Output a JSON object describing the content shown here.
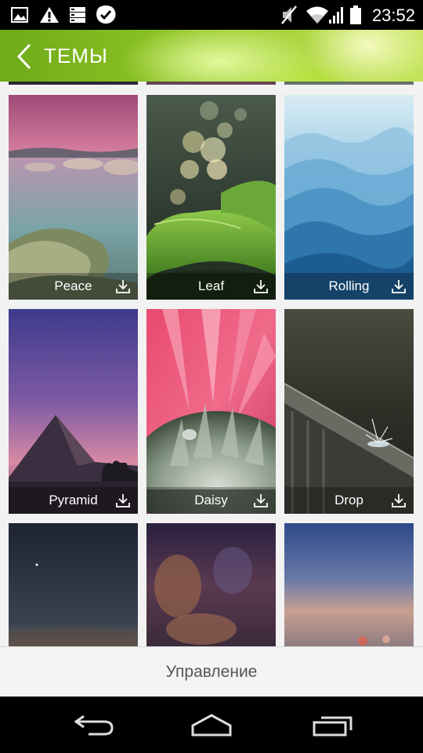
{
  "status_bar": {
    "time": "23:52",
    "icons": [
      "image-notification-icon",
      "warning-icon",
      "storage-icon",
      "check-badge-icon",
      "mute-icon",
      "wifi-icon",
      "signal-icon",
      "battery-icon"
    ]
  },
  "header": {
    "title": "ТЕМЫ",
    "back_icon": "chevron-left-icon",
    "accent_color": "#89c022"
  },
  "themes": [
    {
      "name": "Peace",
      "download_icon": "download-icon"
    },
    {
      "name": "Leaf",
      "download_icon": "download-icon"
    },
    {
      "name": "Rolling",
      "download_icon": "download-icon"
    },
    {
      "name": "Pyramid",
      "download_icon": "download-icon"
    },
    {
      "name": "Daisy",
      "download_icon": "download-icon"
    },
    {
      "name": "Drop",
      "download_icon": "download-icon"
    }
  ],
  "bottom_button": {
    "label": "Управление"
  },
  "nav_bar": {
    "icons": [
      "back-nav-icon",
      "home-nav-icon",
      "recents-nav-icon"
    ]
  }
}
